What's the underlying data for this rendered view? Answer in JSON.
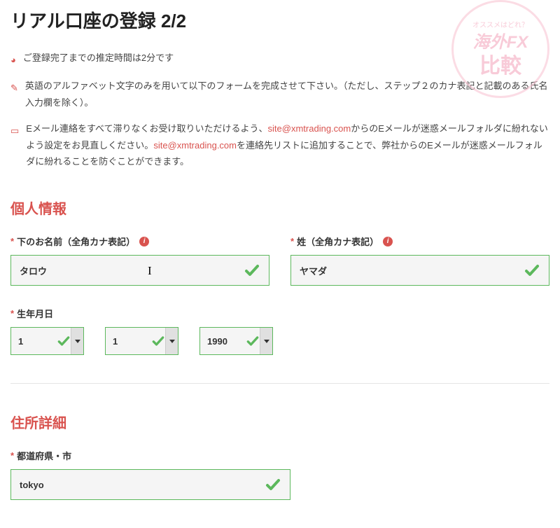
{
  "page": {
    "title": "リアル口座の登録 2/2"
  },
  "watermark": {
    "arc": "オススメはどれ？",
    "line1": "海外FX",
    "line2": "比較"
  },
  "notes": {
    "time": "ご登録完了までの推定時間は2分です",
    "alpha": "英語のアルファベット文字のみを用いて以下のフォームを完成させて下さい。（ただし、ステップ２のカナ表記と記載のある氏名入力欄を除く）。",
    "email_pre": "Eメール連絡をすべて滞りなくお受け取りいただけるよう、",
    "email_link1": "site@xmtrading.com",
    "email_mid1": "からのEメールが迷惑メールフォルダに紛れないよう設定をお見直しください。",
    "email_link2": "site@xmtrading.com",
    "email_mid2": "を連絡先リストに追加することで、弊社からのEメールが迷惑メールフォルダに紛れることを防ぐことができます。"
  },
  "sections": {
    "personal": "個人情報",
    "address": "住所詳細"
  },
  "labels": {
    "first_name": "下のお名前（全角カナ表記）",
    "last_name": "姓（全角カナ表記）",
    "dob": "生年月日",
    "prefecture": "都道府県・市"
  },
  "values": {
    "first_name": "タロウ",
    "last_name": "ヤマダ",
    "dob_day": "1",
    "dob_month": "1",
    "dob_year": "1990",
    "prefecture": "tokyo"
  }
}
